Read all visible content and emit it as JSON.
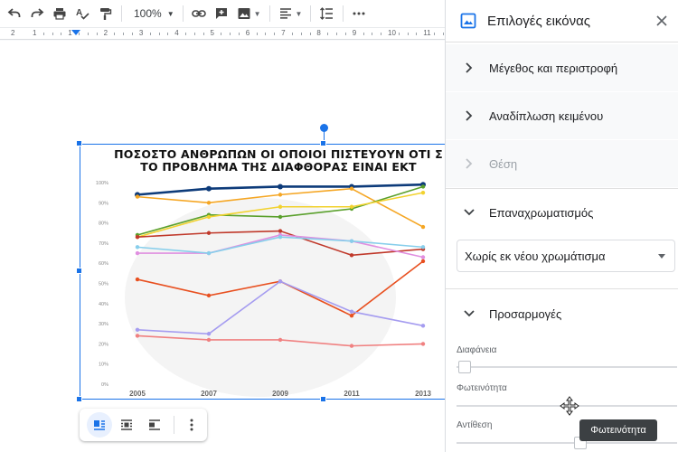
{
  "toolbar": {
    "zoom": "100%",
    "icons": [
      "undo-icon",
      "redo-icon",
      "print-icon",
      "spellcheck-icon",
      "paint-format-icon",
      "link-icon",
      "add-comment-icon",
      "insert-image-icon",
      "align-icon",
      "line-spacing-icon",
      "more-icon"
    ]
  },
  "ruler": {
    "left_label": "2",
    "numbers": [
      "1",
      "1",
      "2",
      "3",
      "4",
      "5",
      "6",
      "7",
      "8",
      "9",
      "10",
      "11"
    ]
  },
  "image": {
    "title_line1": "ΠΟΣΟΣΤΟ ΑΝΘΡΩΠΩΝ ΟΙ ΟΠΟΙΟΙ ΠΙΣΤΕΥΟΥΝ ΟΤΙ Σ",
    "title_line2": "ΤΟ ΠΡΟΒΛΗΜΑ ΤΗΣ ΔΙΑΦΘΟΡΑΣ ΕΙΝΑΙ ΕΚΤ"
  },
  "chart_data": {
    "type": "line",
    "title": "ΠΟΣΟΣΤΟ ΑΝΘΡΩΠΩΝ ΟΙ ΟΠΟΙΟΙ ΠΙΣΤΕΥΟΥΝ ΟΤΙ Σ ΤΟ ΠΡΟΒΛΗΜΑ ΤΗΣ ΔΙΑΦΘΟΡΑΣ ΕΙΝΑΙ ΕΚΤ",
    "x": [
      "2005",
      "2007",
      "2009",
      "2011",
      "2013"
    ],
    "y_ticks": [
      "100%",
      "90%",
      "80%",
      "70%",
      "60%",
      "50%",
      "40%",
      "30%",
      "20%",
      "10%",
      "0%"
    ],
    "ylim": [
      0,
      100
    ],
    "grid": false,
    "series": [
      {
        "color": "#0d3b7a",
        "values": [
          94,
          97,
          98,
          98,
          99
        ]
      },
      {
        "color": "#f5a623",
        "values": [
          93,
          90,
          94,
          97,
          78
        ]
      },
      {
        "color": "#5aa02c",
        "values": [
          74,
          84,
          83,
          87,
          98
        ]
      },
      {
        "color": "#f2d22e",
        "values": [
          73,
          83,
          88,
          88,
          95
        ]
      },
      {
        "color": "#c0392b",
        "values": [
          73,
          75,
          76,
          64,
          67
        ]
      },
      {
        "color": "#e08fe0",
        "values": [
          65,
          65,
          74,
          71,
          63
        ]
      },
      {
        "color": "#87ceeb",
        "values": [
          68,
          65,
          73,
          71,
          68
        ]
      },
      {
        "color": "#e85020",
        "values": [
          52,
          44,
          51,
          34,
          61
        ]
      },
      {
        "color": "#a59cf0",
        "values": [
          27,
          25,
          51,
          36,
          29
        ]
      },
      {
        "color": "#f08080",
        "values": [
          24,
          22,
          22,
          19,
          20
        ]
      }
    ]
  },
  "wrap_toolbar": {
    "icons": [
      "wrap-inline-icon",
      "wrap-text-icon",
      "break-text-icon",
      "more-vert-icon"
    ]
  },
  "panel": {
    "title": "Επιλογές εικόνας",
    "sections": {
      "size": "Μέγεθος και περιστροφή",
      "wrap": "Αναδίπλωση κειμένου",
      "position": "Θέση",
      "recolor": "Επαναχρωματισμός",
      "adjust": "Προσαρμογές"
    },
    "recolor_value": "Χωρίς εκ νέου χρωμάτισμα",
    "adjustments": {
      "transparency": "Διαφάνεια",
      "brightness": "Φωτεινότητα",
      "contrast": "Αντίθεση"
    }
  },
  "tooltip": "Φωτεινότητα"
}
